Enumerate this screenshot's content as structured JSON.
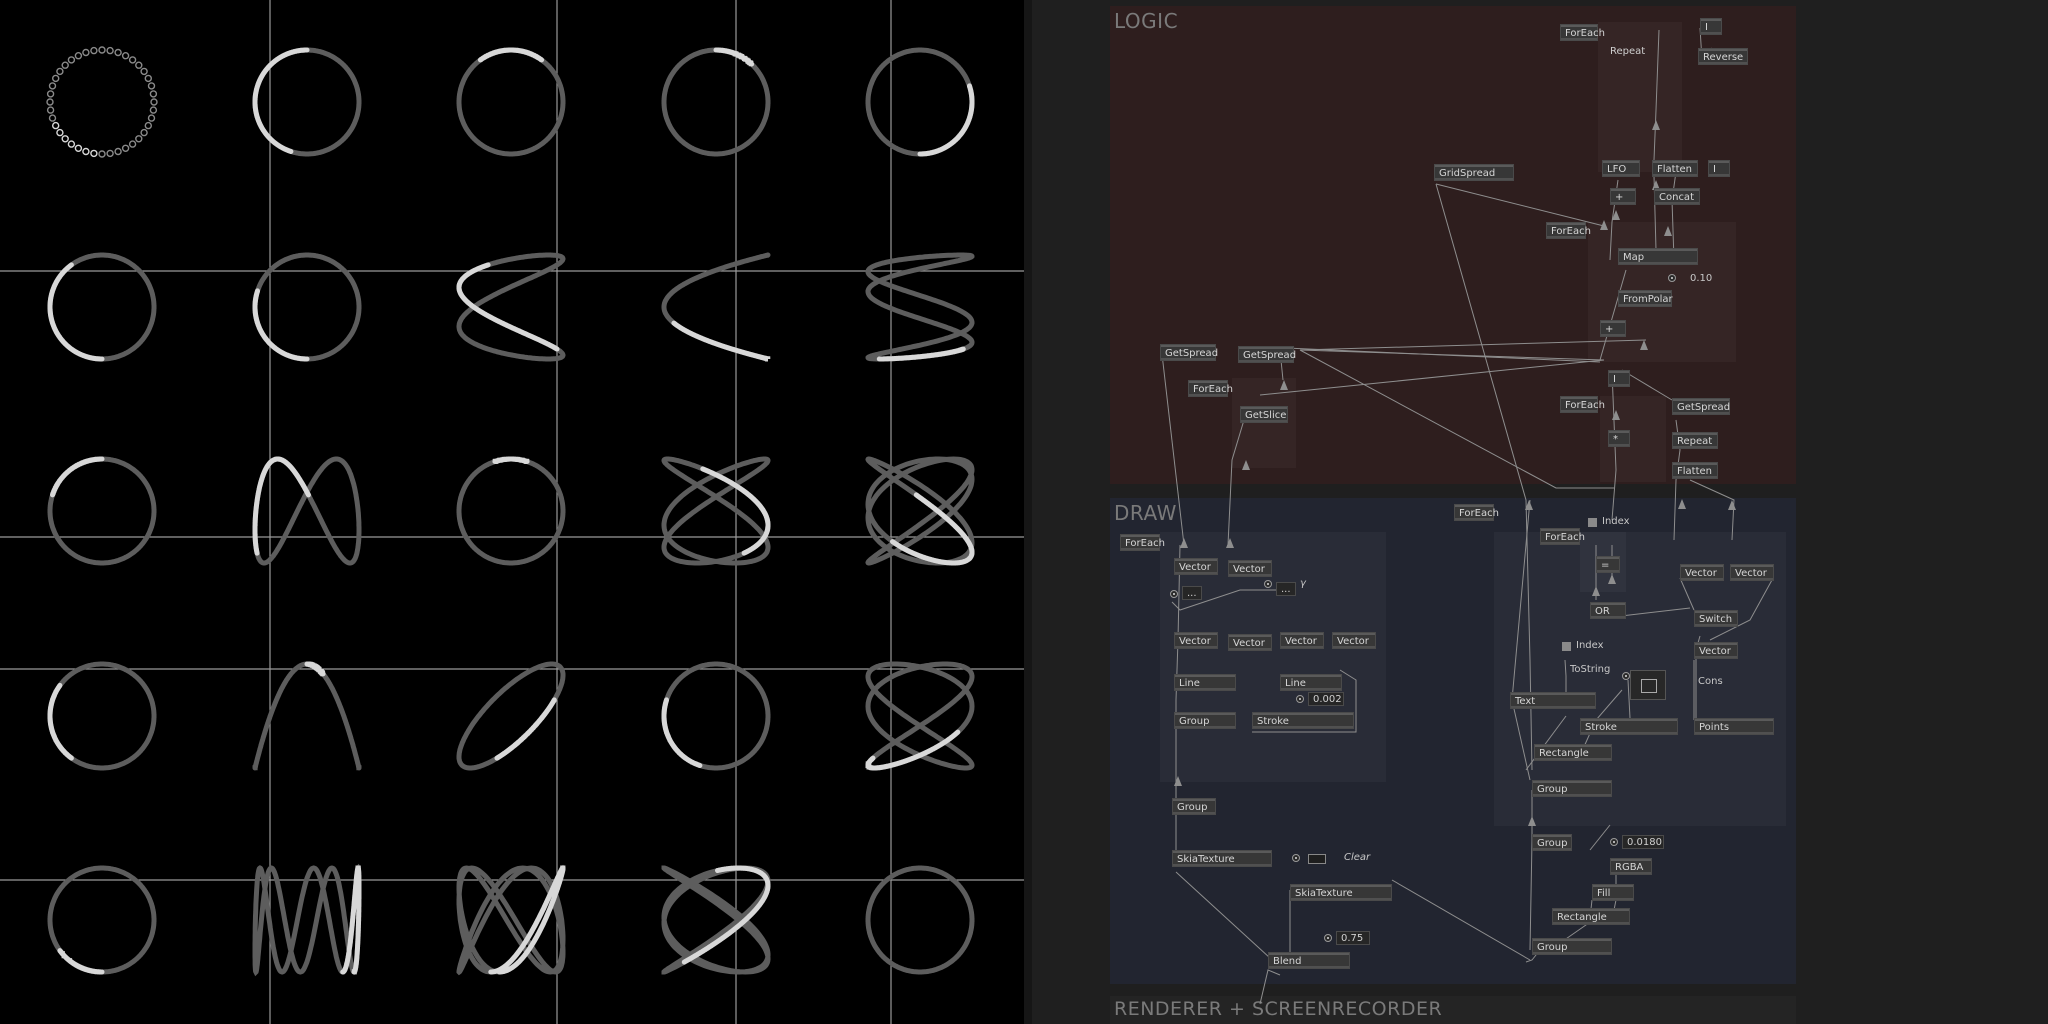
{
  "render_view": {
    "grid": "5x5",
    "curves": [
      [
        "dotted-circle",
        "circle",
        "circle",
        "circle",
        "circle"
      ],
      [
        "circle",
        "circle",
        "lissajous",
        "lissajous",
        "lissajous"
      ],
      [
        "circle",
        "lissajous",
        "circle",
        "lissajous",
        "lissajous"
      ],
      [
        "circle",
        "parabola",
        "lissajous",
        "circle",
        "lissajous"
      ],
      [
        "circle",
        "lissajous",
        "lissajous",
        "lissajous",
        "circle"
      ]
    ],
    "colors": {
      "background": "#000000",
      "curve": "#5d5d5d",
      "highlight": "#d8d8d8",
      "grid_line": "#9a9a9a"
    }
  },
  "regions": {
    "logic": "LOGIC",
    "draw": "DRAW",
    "renderer": "RENDERER + SCREENRECORDER"
  },
  "logic_nodes": {
    "foreach_top": "ForEach",
    "one_top": "I",
    "repeat": "Repeat",
    "reverse": "Reverse",
    "lfo": "LFO",
    "flatten_top": "Flatten",
    "one_mid": "I",
    "plus_top": "+",
    "concat": "Concat",
    "gridspread": "GridSpread",
    "foreach_mid": "ForEach",
    "map": "Map",
    "value_010": "0.10",
    "frompolar": "FromPolar",
    "plus_mid": "+",
    "getspread_left": "GetSpread",
    "getspread_mid": "GetSpread",
    "foreach_getslice": "ForEach",
    "getslice": "GetSlice",
    "one_low": "I",
    "foreach_low": "ForEach",
    "star": "*",
    "getspread_right": "GetSpread",
    "repeat_right": "Repeat",
    "flatten_right": "Flatten"
  },
  "draw_nodes": {
    "foreach_left": "ForEach",
    "vector_a": "Vector",
    "vector_b": "Vector",
    "ellipsis_a": "...",
    "ellipsis_b": "...",
    "gamma": "γ",
    "vector_c": "Vector",
    "vector_d": "Vector",
    "vector_e": "Vector",
    "vector_f": "Vector",
    "line_a": "Line",
    "line_b": "Line",
    "value_0002": "0.002",
    "group_a": "Group",
    "stroke_a": "Stroke",
    "group_b": "Group",
    "skiatexture_a": "SkiaTexture",
    "clear": "Clear",
    "skiatexture_b": "SkiaTexture",
    "value_075": "0.75",
    "blend": "Blend",
    "foreach_draw": "ForEach",
    "foreach_index": "ForEach",
    "index_a": "Index",
    "minus": "=",
    "or": "OR",
    "vector_g": "Vector",
    "vector_h": "Vector",
    "switch": "Switch",
    "vector_i": "Vector",
    "index_b": "Index",
    "tostring": "ToString",
    "text": "Text",
    "stroke_b": "Stroke",
    "cons": "Cons",
    "points": "Points",
    "rectangle_a": "Rectangle",
    "group_c": "Group",
    "group_d": "Group",
    "value_00180": "0.0180",
    "rgba": "RGBA",
    "fill": "Fill",
    "rectangle_b": "Rectangle",
    "group_e": "Group"
  }
}
